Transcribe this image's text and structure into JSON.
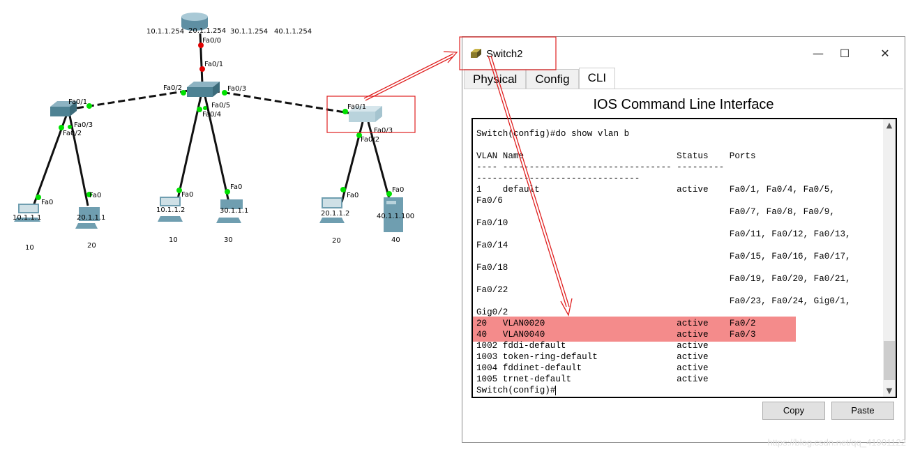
{
  "topology": {
    "router": {
      "interfaces": [
        "10.1.1.254",
        "20.1.1.254",
        "30.1.1.254",
        "40.1.1.254"
      ],
      "port_down": "Fa0/0"
    },
    "core_switch": {
      "up": "Fa0/1",
      "left": "Fa0/2",
      "right": "Fa0/3",
      "p4": "Fa0/4",
      "p5": "Fa0/5"
    },
    "left_switch": {
      "p1": "Fa0/1",
      "p2": "Fa0/2",
      "p3": "Fa0/3"
    },
    "right_switch": {
      "p1": "Fa0/1",
      "p2": "Fa0/2",
      "p3": "Fa0/3"
    },
    "hosts": [
      {
        "ip": "10.1.1.1",
        "port": "Fa0",
        "vlan": "10"
      },
      {
        "ip": "20.1.1.1",
        "port": "Fa0",
        "vlan": "20"
      },
      {
        "ip": "10.1.1.2",
        "port": "Fa0",
        "vlan": "10"
      },
      {
        "ip": "30.1.1.1",
        "port": "Fa0",
        "vlan": "30"
      },
      {
        "ip": "20.1.1.2",
        "port": "Fa0",
        "vlan": "20"
      },
      {
        "ip": "40.1.1.100",
        "port": "Fa0",
        "vlan": "40"
      }
    ],
    "link_up_color": "#00e000",
    "link_down_color": "#e00000",
    "annotation_color": "#e02020"
  },
  "window": {
    "title": "Switch2",
    "icon": "switch-icon",
    "minimize": "—",
    "maximize": "☐",
    "close": "✕",
    "tabs": [
      {
        "label": "Physical"
      },
      {
        "label": "Config"
      },
      {
        "label": "CLI",
        "active": true
      }
    ],
    "heading": "IOS Command Line Interface",
    "cli_lines": [
      "Switch(config)#do show vlan b",
      "",
      "VLAN Name                             Status    Ports",
      "---- -------------------------------- ---------",
      "-------------------------------",
      "1    default                          active    Fa0/1, Fa0/4, Fa0/5,",
      "Fa0/6",
      "                                                Fa0/7, Fa0/8, Fa0/9,",
      "Fa0/10",
      "                                                Fa0/11, Fa0/12, Fa0/13,",
      "Fa0/14",
      "                                                Fa0/15, Fa0/16, Fa0/17,",
      "Fa0/18",
      "                                                Fa0/19, Fa0/20, Fa0/21,",
      "Fa0/22",
      "                                                Fa0/23, Fa0/24, Gig0/1,",
      "Gig0/2",
      "20   VLAN0020                         active    Fa0/2",
      "40   VLAN0040                         active    Fa0/3",
      "1002 fddi-default                     active",
      "1003 token-ring-default               active",
      "1004 fddinet-default                  active",
      "1005 trnet-default                    active"
    ],
    "prompt": "Switch(config)#",
    "highlight_color": "#f48b8b",
    "copy_label": "Copy",
    "paste_label": "Paste"
  },
  "watermark": "https://blog.csdn.net/qq_41901122"
}
